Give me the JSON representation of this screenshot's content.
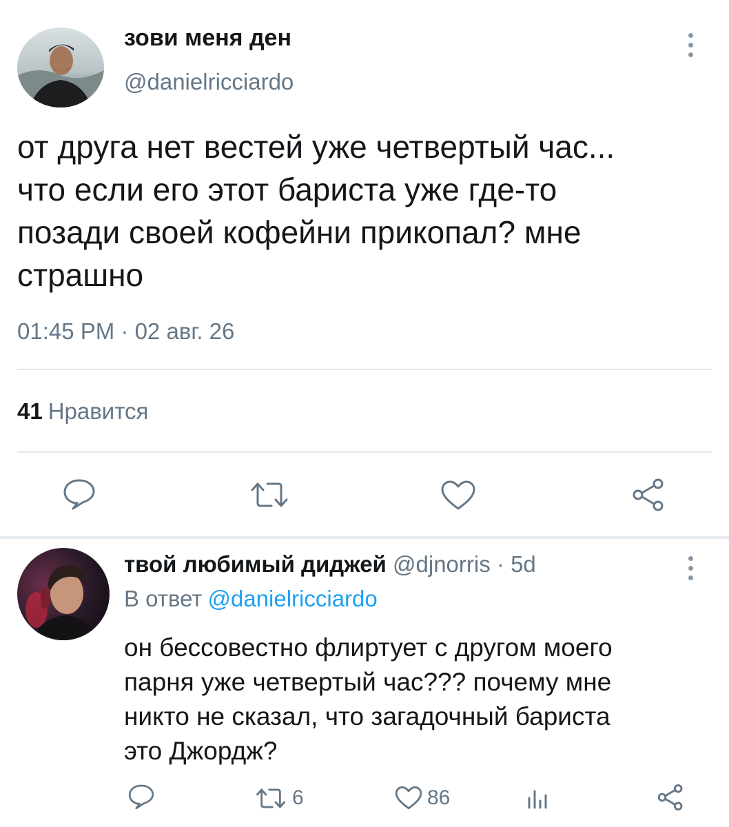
{
  "main_tweet": {
    "author_name": "зови меня ден",
    "author_handle": "@danielricciardo",
    "text": "от друга нет вестей уже четвертый час...\nчто если его этот бариста уже где-то\nпозади своей кофейни прикопал? мне\nстрашно",
    "timestamp": "01:45 PM · 02 авг. 26",
    "likes_count": "41",
    "likes_label": "Нравится",
    "icons": {
      "more": "more-vertical-icon",
      "reply": "reply-icon",
      "retweet": "retweet-icon",
      "like": "heart-icon",
      "share": "share-icon"
    }
  },
  "reply_tweet": {
    "author_name": "твой любимый диджей",
    "author_handle": "@djnorris",
    "dot": "·",
    "time": "5d",
    "reply_prefix": "В ответ",
    "reply_mention": "@danielricciardo",
    "text": "он бессовестно флиртует с другом моего\nпарня уже четвертый час??? почему мне\nникто не сказал, что загадочный бариста\nэто Джордж?",
    "retweet_count": "6",
    "like_count": "86",
    "icons": {
      "more": "more-vertical-icon",
      "reply": "reply-icon",
      "retweet": "retweet-icon",
      "like": "heart-icon",
      "analytics": "analytics-icon",
      "share": "share-icon"
    }
  },
  "colors": {
    "text_primary": "#14171a",
    "text_secondary": "#657786",
    "link": "#1da1f2",
    "divider": "#e1e8ed"
  }
}
